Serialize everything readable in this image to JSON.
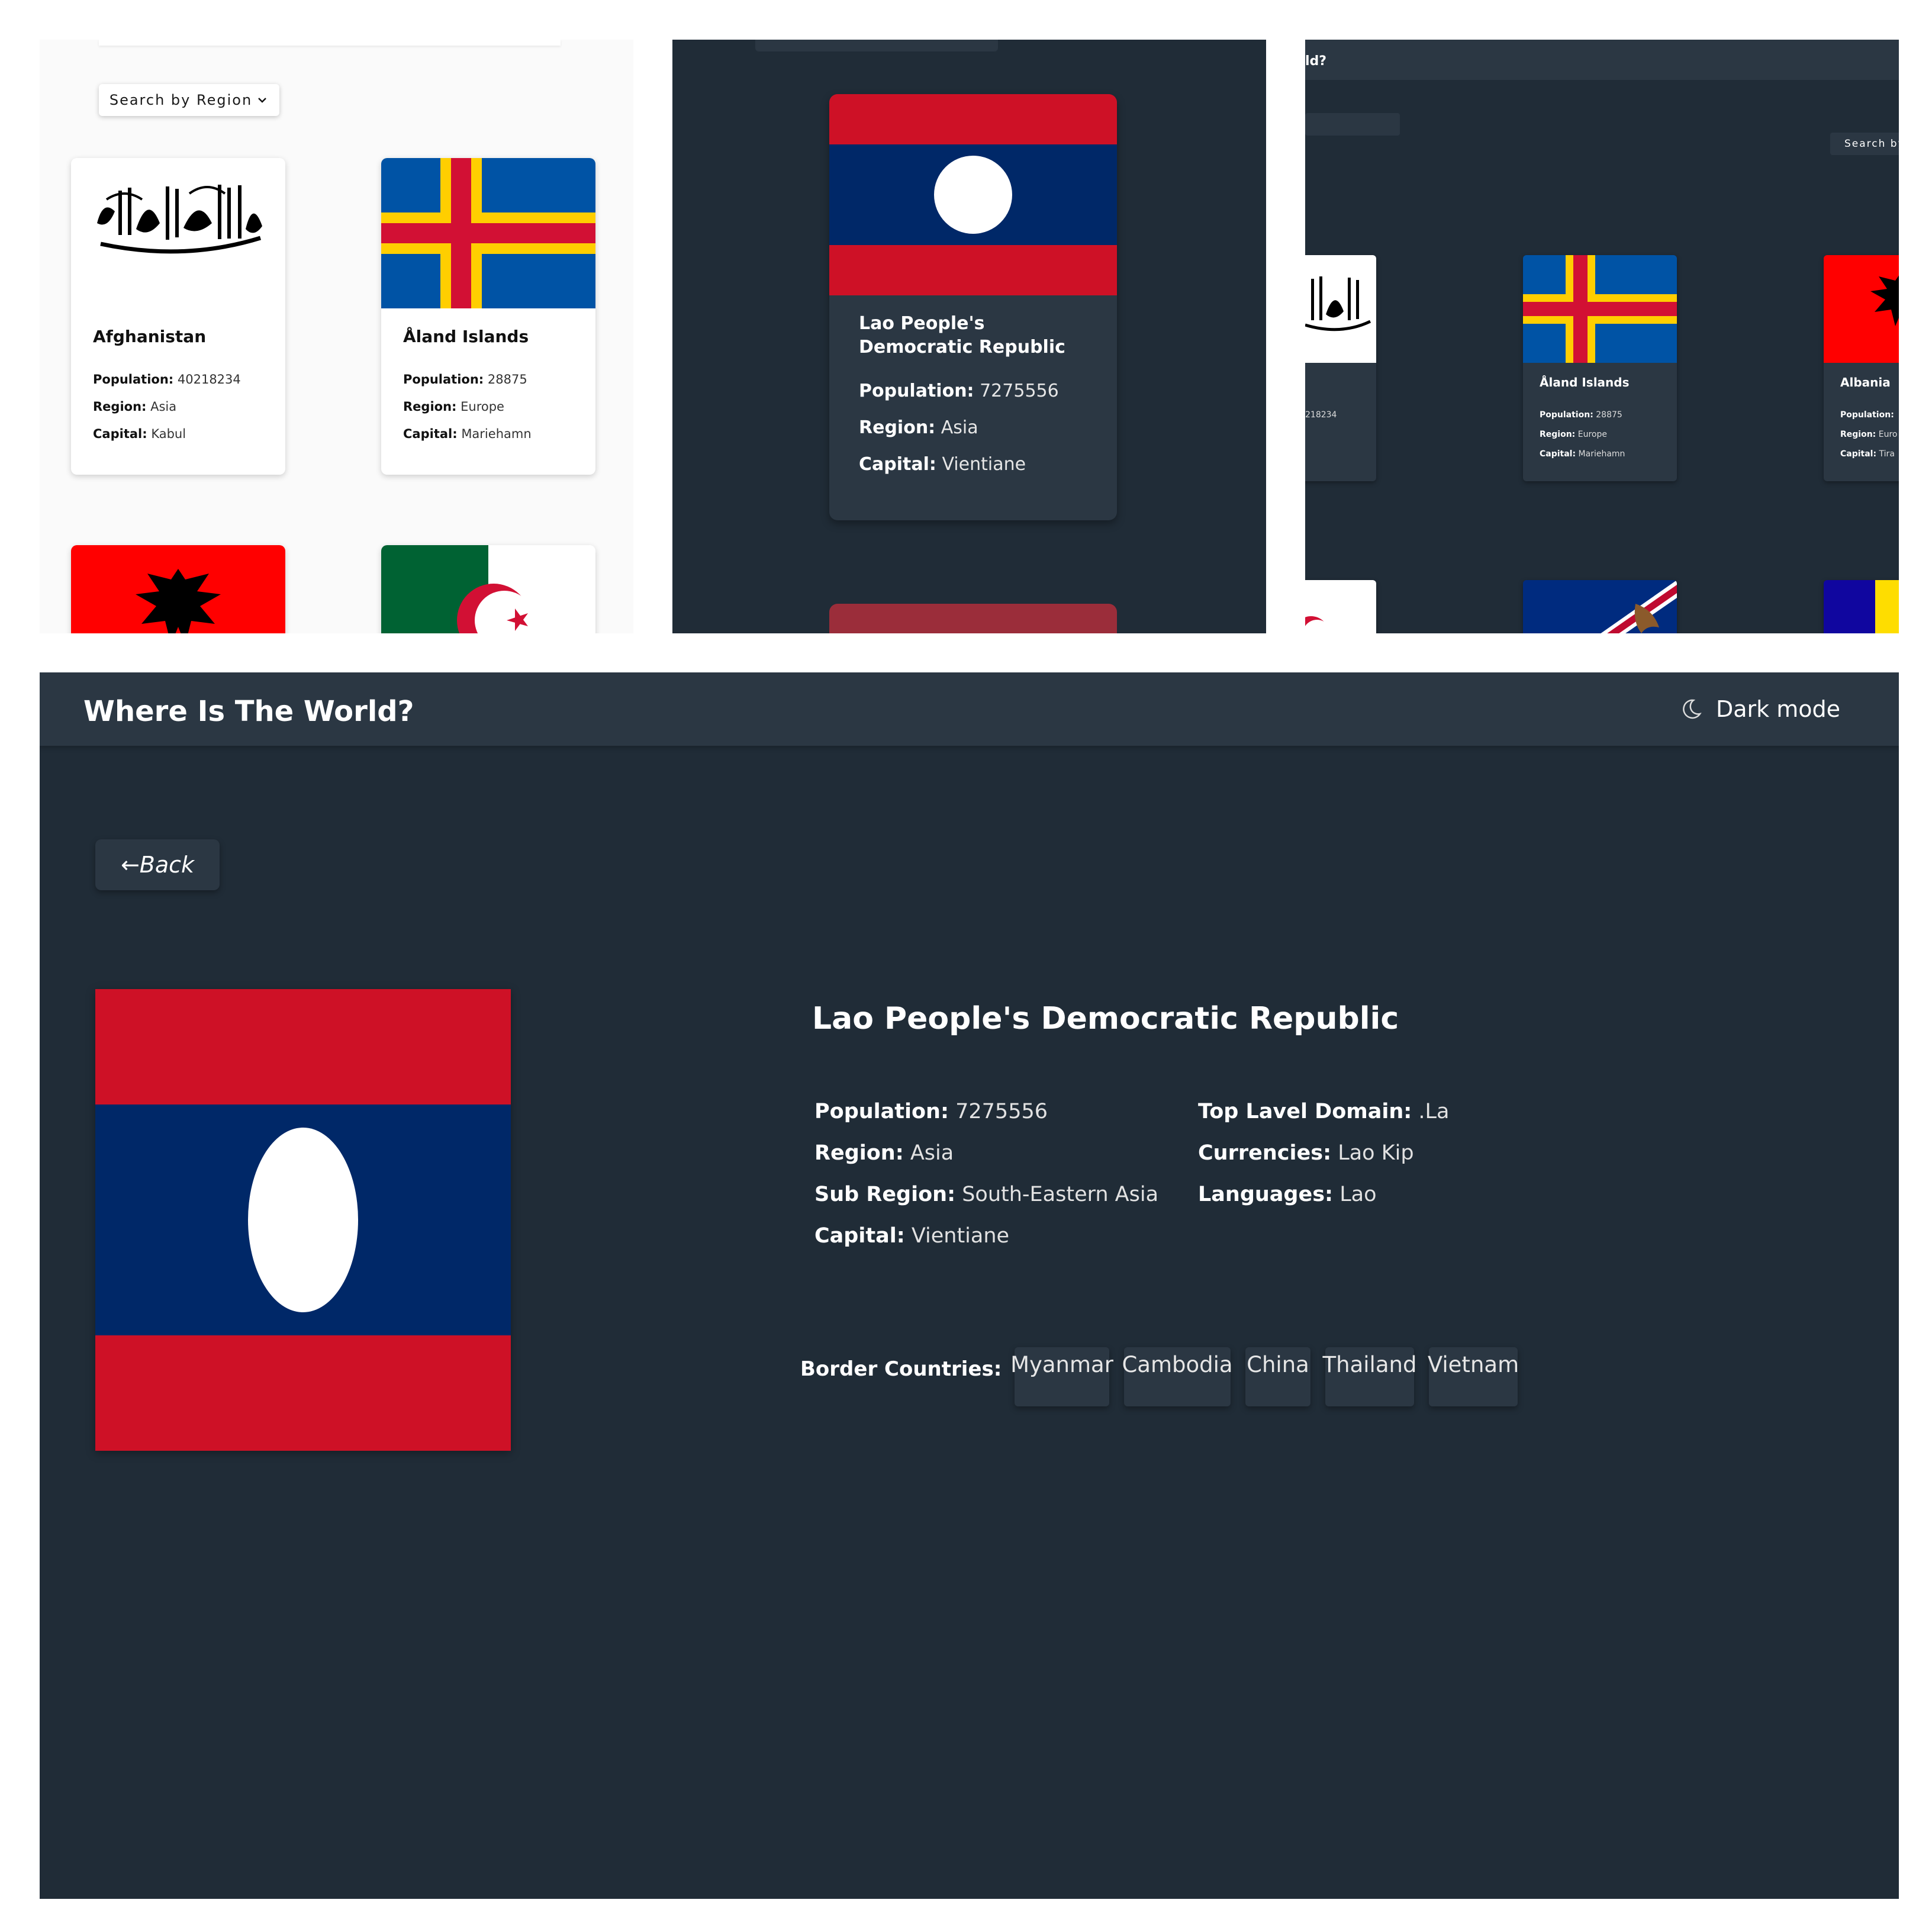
{
  "panel_light_mobile": {
    "filter_label": "Search by Region",
    "cards": [
      {
        "name": "Afghanistan",
        "population_label": "Population:",
        "population": "40218234",
        "region_label": "Region:",
        "region": "Asia",
        "capital_label": "Capital:",
        "capital": "Kabul"
      },
      {
        "name": "Åland Islands",
        "population_label": "Population:",
        "population": "28875",
        "region_label": "Region:",
        "region": "Europe",
        "capital_label": "Capital:",
        "capital": "Mariehamn"
      }
    ]
  },
  "panel_dark_mobile": {
    "card": {
      "name": "Lao People's Democratic Republic",
      "population_label": "Population:",
      "population": "7275556",
      "region_label": "Region:",
      "region": "Asia",
      "capital_label": "Capital:",
      "capital": "Vientiane"
    }
  },
  "panel_dark_desktop": {
    "header_title_fragment": "ld?",
    "filter_label_fragment": "Search by",
    "partial_population": "218234",
    "cards": [
      {
        "name": "Åland Islands",
        "population_label": "Population:",
        "population": "28875",
        "region_label": "Region:",
        "region": "Europe",
        "capital_label": "Capital:",
        "capital": "Mariehamn"
      },
      {
        "name": "Albania",
        "population_label": "Population:",
        "region_label": "Region:",
        "region_fragment": "Euro",
        "capital_label": "Capital:",
        "capital_fragment": "Tira"
      }
    ]
  },
  "detail_page": {
    "app_title": "Where Is The World?",
    "theme_toggle_label": "Dark mode",
    "back_label": "←Back",
    "country_name": "Lao People's Democratic Republic",
    "left_info": [
      {
        "label": "Population:",
        "value": "7275556"
      },
      {
        "label": "Region:",
        "value": "Asia"
      },
      {
        "label": "Sub Region:",
        "value": "South-Eastern Asia"
      },
      {
        "label": "Capital:",
        "value": "Vientiane"
      }
    ],
    "right_info": [
      {
        "label": "Top Lavel Domain:",
        "value": ".La"
      },
      {
        "label": "Currencies:",
        "value": "Lao Kip"
      },
      {
        "label": "Languages:",
        "value": "Lao"
      }
    ],
    "border_label": "Border Countries:",
    "border_countries": [
      "Myanmar",
      "Cambodia",
      "China",
      "Thailand",
      "Vietnam"
    ]
  },
  "colors": {
    "dark_background": "#202c37",
    "dark_element": "#2b3743",
    "light_background": "#fafafa",
    "laos_red": "#ce1126",
    "laos_blue": "#002868"
  },
  "icons": [
    "moon-icon",
    "chevron-down-icon",
    "back-arrow-icon"
  ]
}
